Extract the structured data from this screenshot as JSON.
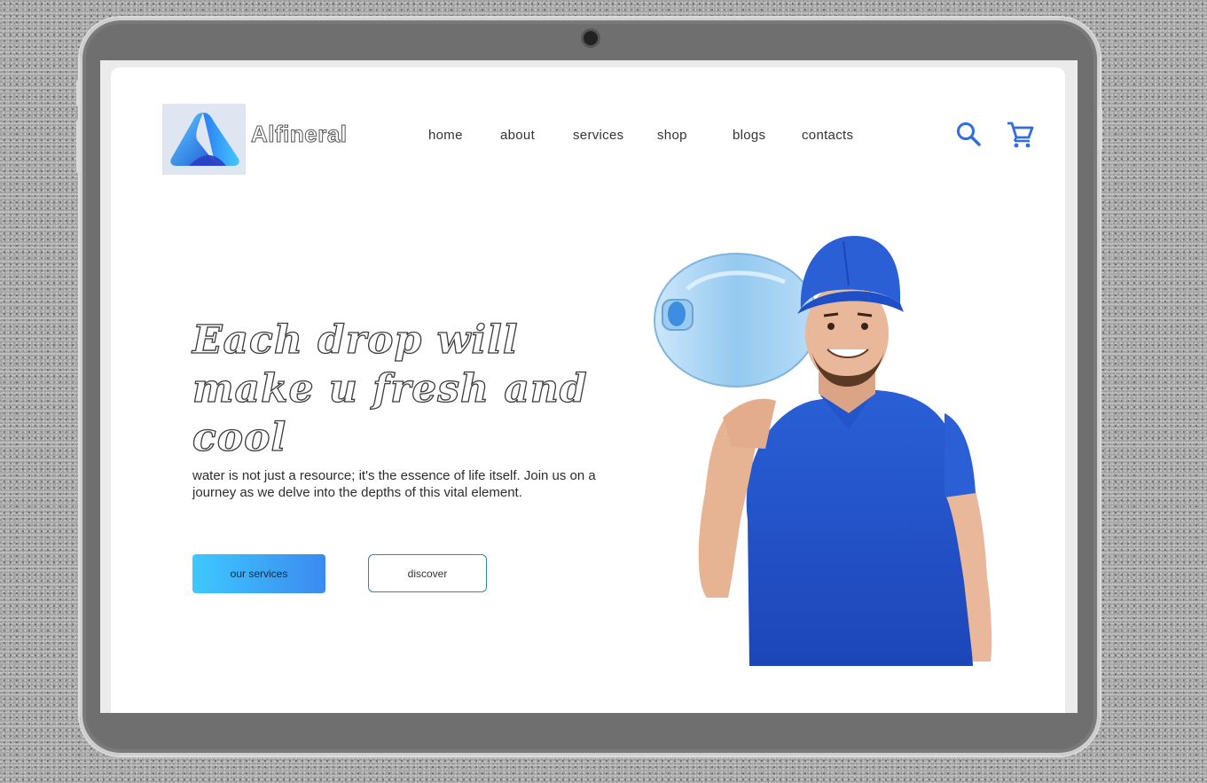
{
  "brand": {
    "name": "Alfineral",
    "logo_icon": "triangle-logo-icon"
  },
  "nav": {
    "items": [
      {
        "label": "home"
      },
      {
        "label": "about"
      },
      {
        "label": "services"
      },
      {
        "label": "shop"
      },
      {
        "label": "blogs"
      },
      {
        "label": "contacts"
      }
    ]
  },
  "header_icons": {
    "search": "search-icon",
    "cart": "cart-icon"
  },
  "hero": {
    "headline": "Each drop will make u fresh and cool",
    "subtext": "water is not just a resource; it's the essence of life itself. Join us on a journey as we delve into the depths of this vital element.",
    "primary_button": "our services",
    "secondary_button": "discover",
    "image": "delivery-man-with-water-bottle"
  },
  "colors": {
    "accent": "#2f6de0",
    "gradient_start": "#3ec8ff",
    "gradient_end": "#3b8af0",
    "outline_button": "#2a8ea3",
    "uniform_blue": "#1f4fc7"
  }
}
